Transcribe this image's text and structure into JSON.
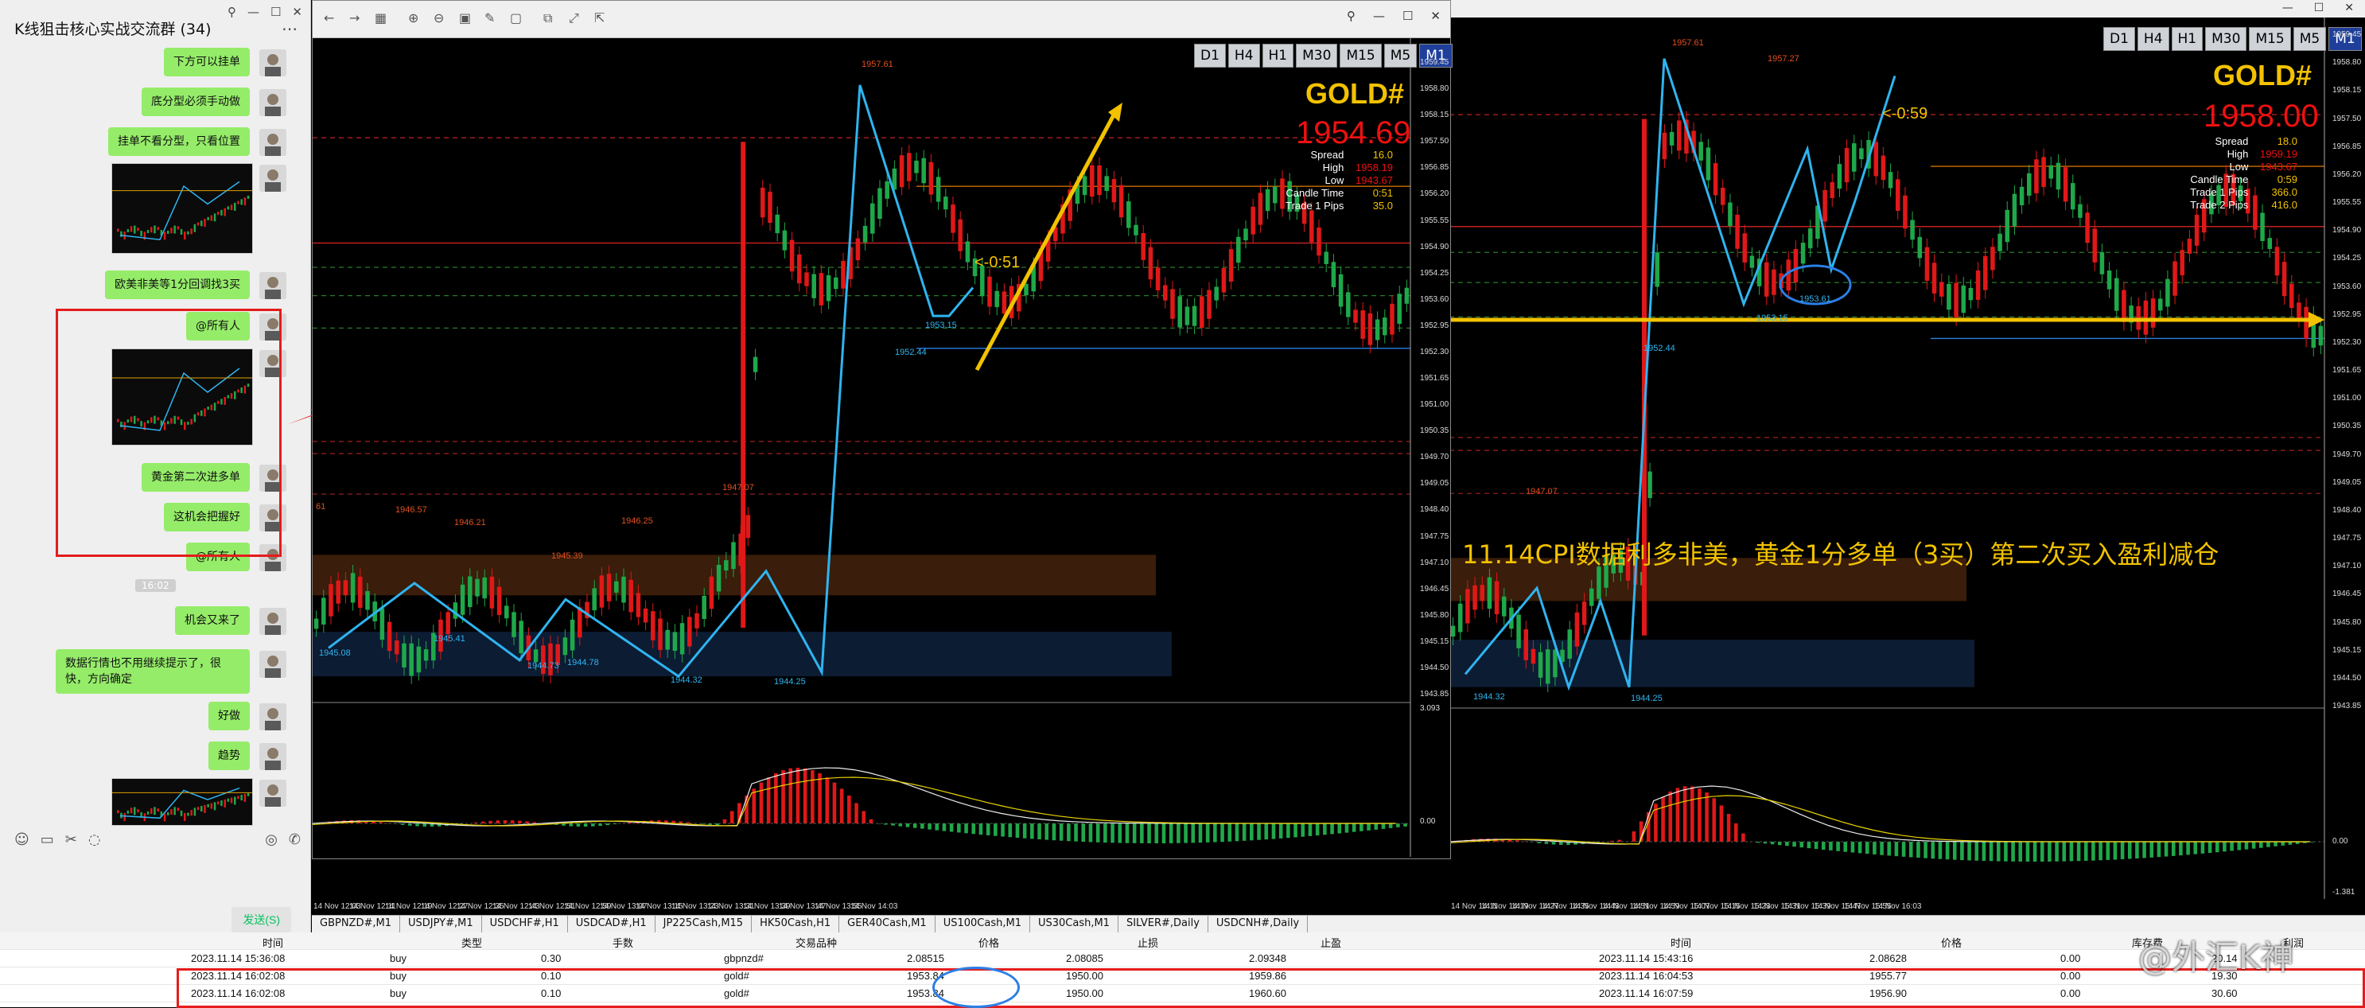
{
  "chat": {
    "title": "K线狙击核心实战交流群 (34)",
    "messages": [
      {
        "text": "下方可以挂单"
      },
      {
        "text": "底分型必须手动做"
      },
      {
        "text": "挂单不看分型，只看位置"
      },
      {
        "text": "欧美非美等1分回调找3买"
      },
      {
        "text": "@所有人"
      },
      {
        "text": "黄金第二次进多单"
      },
      {
        "text": "这机会把握好"
      },
      {
        "text": "@所有人"
      },
      {
        "text": "机会又来了"
      },
      {
        "text": "数据行情也不用继续提示了，很快，方向确定"
      },
      {
        "text": "好做"
      },
      {
        "text": "趋势"
      }
    ],
    "timestamp": "16:02",
    "send_label": "发送(S)"
  },
  "window_controls": {
    "minimize": "—",
    "maximize": "☐",
    "close": "✕"
  },
  "chart1": {
    "timeframes": [
      "D1",
      "H4",
      "H1",
      "M30",
      "M15",
      "M5",
      "M1"
    ],
    "active_tf": "M1",
    "symbol": "GOLD#",
    "price": "1954.69",
    "info": {
      "spread": "16.0",
      "high": "1958.19",
      "low": "1943.67",
      "candle_time": "0:51",
      "trade1_pips": "35.0"
    },
    "countdown": "<-0:51",
    "annotations": [
      "1957.61",
      "1952.44",
      "1953.15",
      "1947.07",
      "1946.57",
      "1946.21",
      "1946.25",
      "1945.39",
      "1945.41",
      "1945.08",
      "1944.73",
      "1944.78",
      "1944.32",
      "1944.25",
      "61"
    ],
    "axis": [
      "1959.45",
      "1958.80",
      "1958.15",
      "1957.50",
      "1956.85",
      "1956.20",
      "1955.55",
      "1954.90",
      "1954.25",
      "1953.60",
      "1952.95",
      "1952.30",
      "1951.65",
      "1951.00",
      "1950.35",
      "1949.70",
      "1949.05",
      "1948.40",
      "1947.75",
      "1947.10",
      "1946.45",
      "1945.80",
      "1945.15",
      "1944.50",
      "1943.85",
      "3.093",
      "0.00"
    ],
    "chart_data": {
      "type": "line",
      "title": "GOLD# M1",
      "ylim": [
        1943.85,
        1959.45
      ],
      "series": [
        {
          "name": "zigzag",
          "values": [
            1945.08,
            1946.57,
            1944.73,
            1946.21,
            1944.25,
            1958.9,
            1953.15,
            1956.5
          ]
        }
      ]
    }
  },
  "chart2": {
    "timeframes": [
      "D1",
      "H4",
      "H1",
      "M30",
      "M15",
      "M5",
      "M1"
    ],
    "active_tf": "M1",
    "symbol": "GOLD#",
    "price": "1958.00",
    "info": {
      "spread": "18.0",
      "high": "1959.19",
      "low": "1943.67",
      "candle_time": "0:59",
      "trade1_pips": "366.0",
      "trade2_pips": "416.0"
    },
    "countdown": "<-0:59",
    "annotations": [
      "1957.61",
      "1957.27",
      "1952.44",
      "1953.61",
      "1953.15",
      "1947.07",
      "1944.32",
      "1944.25"
    ],
    "headline": "11.14CPI数据利多非美，黄金1分多单（3买）第二次买入盈利减仓",
    "axis": [
      "1959.45",
      "1958.80",
      "1958.15",
      "1957.50",
      "1956.85",
      "1956.20",
      "1955.55",
      "1954.90",
      "1954.25",
      "1953.60",
      "1952.95",
      "1952.30",
      "1951.65",
      "1951.00",
      "1950.35",
      "1949.70",
      "1949.05",
      "1948.40",
      "1947.75",
      "1947.10",
      "1946.45",
      "1945.80",
      "1945.15",
      "1944.50",
      "1943.85",
      "0.00",
      "-1.381"
    ]
  },
  "time_axis": [
    "14 Nov 12:03",
    "14 Nov 12:11",
    "14 Nov 12:19",
    "14 Nov 12:27",
    "14 Nov 12:35",
    "14 Nov 12:43",
    "14 Nov 12:51",
    "14 Nov 12:59",
    "14 Nov 13:07",
    "14 Nov 13:15",
    "14 Nov 13:23",
    "14 Nov 13:31",
    "14 Nov 13:39",
    "14 Nov 13:47",
    "14 Nov 13:55",
    "14 Nov 14:03",
    "14 Nov 14:11",
    "14 Nov 14:19",
    "14 Nov 14:27",
    "14 Nov 14:35",
    "14 Nov 14:43",
    "14 Nov 14:51",
    "14 Nov 14:59",
    "14 Nov 15:07",
    "14 Nov 15:15",
    "14 Nov 15:23",
    "14 Nov 15:31",
    "14 Nov 15:39",
    "14 Nov 15:47",
    "14 Nov 15:55",
    "14 Nov 16:03"
  ],
  "tabs": [
    "GBPNZD#,M1",
    "USDJPY#,M1",
    "USDCHF#,H1",
    "USDCAD#,H1",
    "JP225Cash,M15",
    "HK50Cash,H1",
    "GER40Cash,M1",
    "US100Cash,M1",
    "US30Cash,M1",
    "SILVER#,Daily",
    "USDCNH#,Daily"
  ],
  "trades": {
    "headers": [
      "时间",
      "类型",
      "手数",
      "交易品种",
      "价格",
      "止损",
      "止盈",
      "时间",
      "价格",
      "库存费",
      "利润"
    ],
    "rows": [
      [
        "2023.11.14 15:36:08",
        "buy",
        "0.30",
        "gbpnzd#",
        "2.08515",
        "2.08085",
        "2.09348",
        "2023.11.14 15:43:16",
        "2.08628",
        "0.00",
        "20.14"
      ],
      [
        "2023.11.14 16:02:08",
        "buy",
        "0.10",
        "gold#",
        "1953.84",
        "1950.00",
        "1959.86",
        "2023.11.14 16:04:53",
        "1955.77",
        "0.00",
        "19.30"
      ],
      [
        "2023.11.14 16:02:08",
        "buy",
        "0.10",
        "gold#",
        "1953.84",
        "1950.00",
        "1960.60",
        "2023.11.14 16:07:59",
        "1956.90",
        "0.00",
        "30.60"
      ]
    ]
  },
  "watermark": "@外汇K神",
  "colors": {
    "bull": "#1fa84a",
    "bear": "#e01818",
    "zigzag": "#2fb4f0",
    "gold": "#f2c200"
  }
}
